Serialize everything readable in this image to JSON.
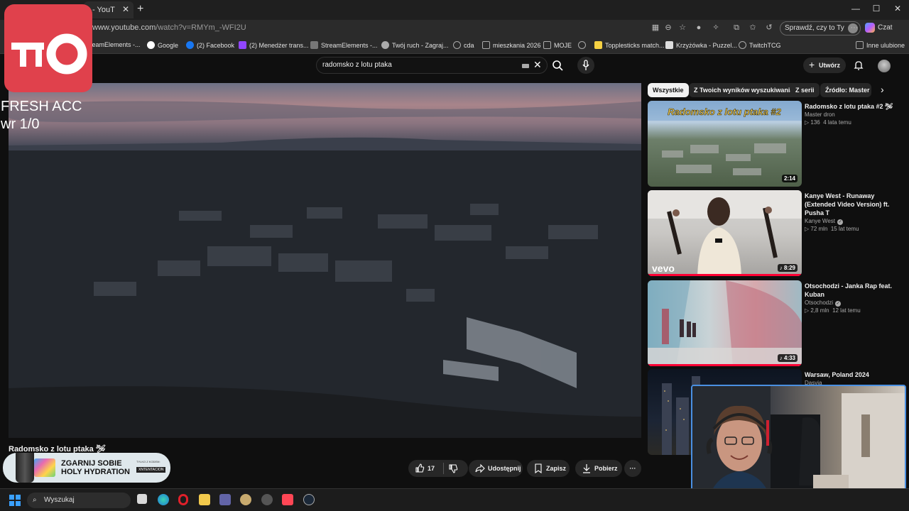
{
  "browser": {
    "tab_title": "- YouT",
    "window_controls": [
      "—",
      "☐",
      "✕"
    ],
    "url_host": "www.youtube.com",
    "url_path": "/watch?v=RMYm_-WFI2U",
    "signin_label": "Sprawdź, czy to Ty",
    "copilot_label": "Czat",
    "bookmarks": [
      {
        "label": "treamElements -...",
        "icon": "streamelements-icon",
        "color": "#8a8a8a"
      },
      {
        "label": "Google",
        "icon": "google-icon",
        "color": "#4285f4"
      },
      {
        "label": "(2) Facebook",
        "icon": "facebook-icon",
        "color": "#1877f2"
      },
      {
        "label": "(2) Menedżer trans...",
        "icon": "twitch-icon",
        "color": "#9146ff"
      },
      {
        "label": "StreamElements -...",
        "icon": "streamelements-icon",
        "color": "#cccccc"
      },
      {
        "label": "Twój ruch - Zagraj...",
        "icon": "chess-icon",
        "color": "#bbbbbb"
      },
      {
        "label": "cda",
        "icon": "globe-icon",
        "color": "#999999"
      },
      {
        "label": "mieszkania 2026",
        "icon": "folder-icon",
        "color": "#999999"
      },
      {
        "label": "MOJE",
        "icon": "folder-icon",
        "color": "#999999"
      },
      {
        "label": "",
        "icon": "globe-icon",
        "color": "#999999"
      },
      {
        "label": "Topplesticks match...",
        "icon": "topplesticks-icon",
        "color": "#f5d142"
      },
      {
        "label": "Krzyżówka - Puzzel...",
        "icon": "puzzel-icon",
        "color": "#dddddd"
      },
      {
        "label": "TwitchTCG",
        "icon": "globe-icon",
        "color": "#999999"
      }
    ],
    "other_favorites": "Inne ulubione"
  },
  "overlay": {
    "line1": "FRESH ACC",
    "line2": "wr 1/0"
  },
  "youtube": {
    "search_value": "radomsko z lotu ptaka",
    "create_label": "Utwórz",
    "video_title": "Radomsko z lotu ptaka 🛩",
    "like_count": "17",
    "share_label": "Udostępnij",
    "save_label": "Zapisz",
    "download_label": "Pobierz",
    "more_label": "···",
    "chips": [
      "Wszystkie",
      "Z Twoich wyników wyszukiwania",
      "Z serii",
      "Źródło: Master d"
    ],
    "recommendations": [
      {
        "title": "Radomsko z lotu ptaka #2 🛩",
        "channel": "Master dron",
        "views": "136",
        "age": "4 lata temu",
        "duration": "2:14",
        "thumb_text": "Radomsko z lotu ptaka #2",
        "verified": false
      },
      {
        "title": "Kanye West - Runaway (Extended Video Version) ft. Pusha T",
        "channel": "Kanye West",
        "views": "72 mln",
        "age": "15 lat temu",
        "duration": "8:29",
        "thumb_text": "vevo",
        "verified": true
      },
      {
        "title": "Otsochodzi - Janka Rap feat. Kuban",
        "channel": "Otsochodzi",
        "views": "2,8 mln",
        "age": "12 lat temu",
        "duration": "4:33",
        "thumb_text": "",
        "verified": true
      },
      {
        "title": "Warsaw, Poland 2024",
        "channel": "Dasvia",
        "views": "",
        "age": "",
        "duration": "",
        "thumb_text": "",
        "verified": false
      }
    ]
  },
  "promo": {
    "title": "ZGARNIJ SOBIE HOLY HYDRATION",
    "small": "TYLKO Z KODEM:",
    "brand": "XNTENTACION"
  },
  "taskbar": {
    "search_placeholder": "Wyszukaj",
    "apps": [
      "file-explorer-icon",
      "edge-icon",
      "opera-icon",
      "folder-icon",
      "teams-icon",
      "league-icon",
      "app-icon",
      "valorant-icon",
      "steam-icon"
    ]
  }
}
